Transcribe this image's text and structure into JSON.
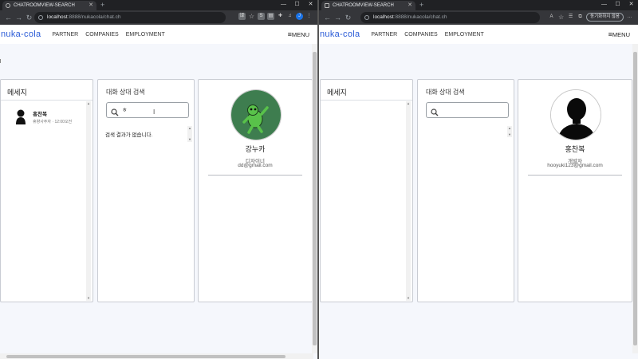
{
  "left": {
    "browser": {
      "tab_title": "CHATROOMVIEW-SEARCH",
      "url_host": "localhost",
      "url_rest": ":8888/nukacola/chat.ch"
    },
    "app": {
      "logo": "nuka-cola",
      "nav": [
        "PARTNER",
        "COMPANIES",
        "EMPLOYMENT"
      ],
      "menu": "MENU"
    },
    "messages_panel": {
      "title": "메세지",
      "rooms": [
        {
          "name": "홍찬복",
          "subtitle": "휴향사주자 · 12:00오전"
        }
      ]
    },
    "search_panel": {
      "title": "대화 상대 검색",
      "query": "ㅎ",
      "empty_text": "검색 결과가 없습니다."
    },
    "profile": {
      "name": "강누카",
      "job": "디자이너",
      "email": "dd@gmail.com"
    }
  },
  "right": {
    "browser": {
      "tab_title": "CHATROOMVIEW-SEARCH",
      "url_host": "localhost",
      "url_rest": ":8888/nukacola/chat.ch",
      "sync_label": "동기화하지 않음"
    },
    "app": {
      "logo": "nuka-cola",
      "nav": [
        "PARTNER",
        "COMPANIES",
        "EMPLOYMENT"
      ],
      "menu": "MENU"
    },
    "messages_panel": {
      "title": "메세지"
    },
    "search_panel": {
      "title": "대화 상대 검색",
      "query": ""
    },
    "profile": {
      "name": "홍찬복",
      "job": "개발자",
      "email": "hooyuki123@gmail.com"
    }
  },
  "colors": {
    "accent": "#2a5bd7",
    "frog_bg": "#3e7d4f",
    "frog_body": "#59c24a",
    "chrome_dark": "#202124"
  }
}
